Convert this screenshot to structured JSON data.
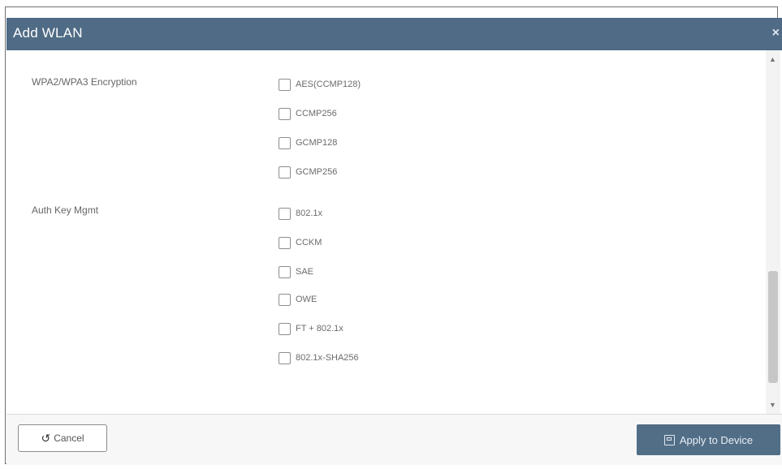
{
  "dialog": {
    "title": "Add WLAN",
    "close_glyph": "×"
  },
  "encryption": {
    "label": "WPA2/WPA3 Encryption",
    "options": [
      {
        "label": "AES(CCMP128)",
        "checked": false
      },
      {
        "label": "CCMP256",
        "checked": false
      },
      {
        "label": "GCMP128",
        "checked": false
      },
      {
        "label": "GCMP256",
        "checked": false
      }
    ]
  },
  "akm": {
    "label": "Auth Key Mgmt",
    "options": [
      {
        "label": "802.1x",
        "checked": false
      },
      {
        "label": "CCKM",
        "checked": false
      },
      {
        "label": "SAE",
        "checked": false
      },
      {
        "label": "OWE",
        "checked": false
      },
      {
        "label": "FT + 802.1x",
        "checked": false
      },
      {
        "label": "802.1x-SHA256",
        "checked": false
      }
    ]
  },
  "footer": {
    "cancel_label": "Cancel",
    "cancel_icon": "undo-icon",
    "apply_label": "Apply to Device",
    "apply_icon": "save-icon"
  },
  "colors": {
    "titlebar": "#4f6b85",
    "apply_button": "#526e87"
  }
}
